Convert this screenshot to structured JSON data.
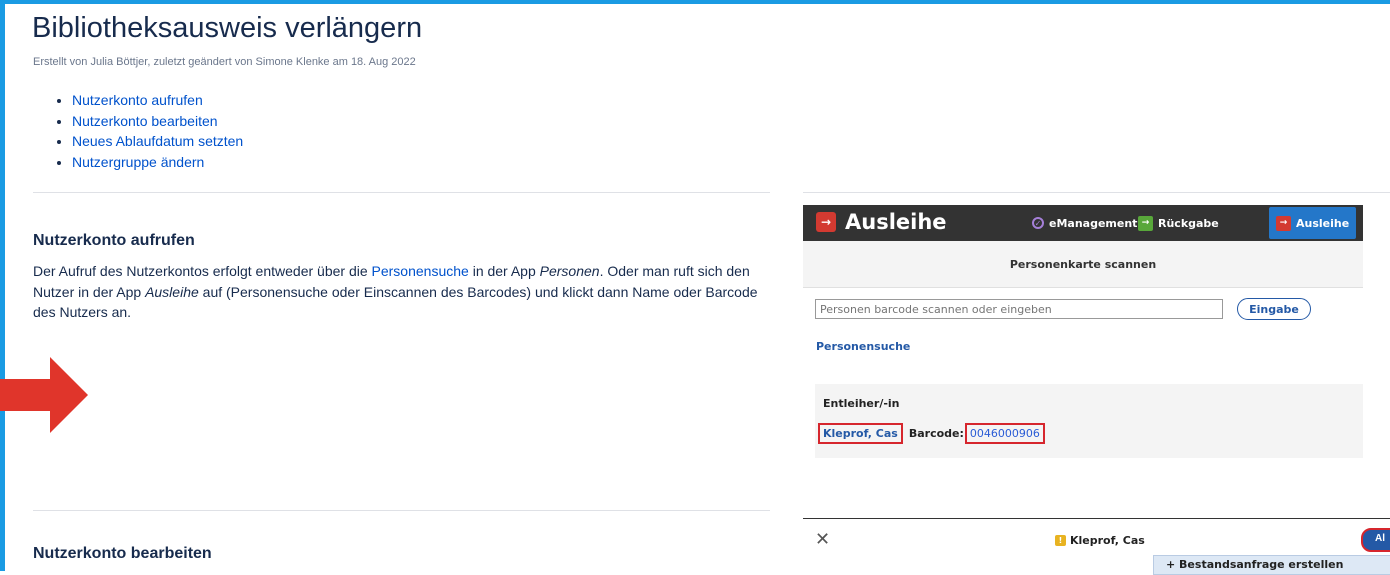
{
  "page": {
    "title": "Bibliotheksausweis verlängern",
    "byline": "Erstellt von Julia Böttjer, zuletzt geändert von Simone Klenke am 18. Aug 2022",
    "toc": [
      "Nutzerkonto aufrufen",
      "Nutzerkonto bearbeiten",
      "Neues Ablaufdatum setzten",
      "Nutzergruppe ändern"
    ]
  },
  "section1": {
    "heading": "Nutzerkonto aufrufen",
    "text_1": "Der Aufruf des Nutzerkontos erfolgt entweder über die ",
    "link_personensuche": "Personensuche",
    "text_2": " in der App ",
    "app_personen": "Personen",
    "text_3": ". Oder man ruft sich den Nutzer in der App ",
    "app_ausleihe": "Ausleihe",
    "text_4": " auf (Personensuche oder Einscannen des Barcodes) und klickt dann Name oder Barcode des Nutzers an."
  },
  "section2": {
    "heading": "Nutzerkonto bearbeiten"
  },
  "screenshot": {
    "app_title": "Ausleihe",
    "nav": {
      "emanagement": "eManagement",
      "rueckgabe": "Rückgabe",
      "ausleihe": "Ausleihe"
    },
    "scan_title": "Personenkarte scannen",
    "barcode_placeholder": "Personen barcode scannen oder eingeben",
    "eingabe_button": "Eingabe",
    "personensuche_link": "Personensuche",
    "entleiher_label": "Entleiher/-in",
    "person_name": "Kleprof, Cas",
    "barcode_label": "Barcode:",
    "barcode_value": "0046000906",
    "modal_name": "Kleprof, Cas",
    "modal_button": "Al",
    "dropdown_item": "+ Bestandsanfrage erstellen"
  },
  "colors": {
    "accent": "#1a9be3",
    "link": "#0052cc",
    "arrow": "#e0352b",
    "highlight": "#d6262d"
  }
}
